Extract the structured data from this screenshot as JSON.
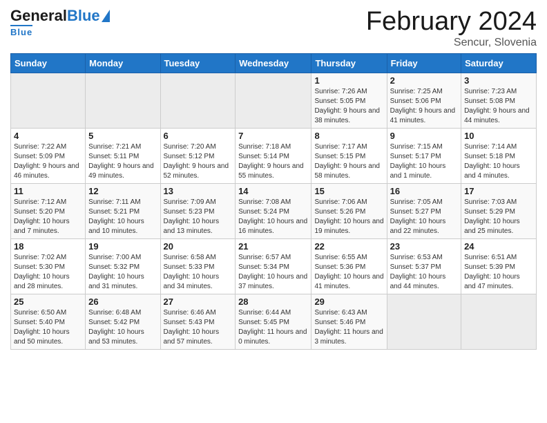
{
  "header": {
    "logo_general": "General",
    "logo_blue": "Blue",
    "month": "February 2024",
    "location": "Sencur, Slovenia"
  },
  "days_of_week": [
    "Sunday",
    "Monday",
    "Tuesday",
    "Wednesday",
    "Thursday",
    "Friday",
    "Saturday"
  ],
  "weeks": [
    [
      {
        "day": "",
        "info": ""
      },
      {
        "day": "",
        "info": ""
      },
      {
        "day": "",
        "info": ""
      },
      {
        "day": "",
        "info": ""
      },
      {
        "day": "1",
        "info": "Sunrise: 7:26 AM\nSunset: 5:05 PM\nDaylight: 9 hours and 38 minutes."
      },
      {
        "day": "2",
        "info": "Sunrise: 7:25 AM\nSunset: 5:06 PM\nDaylight: 9 hours and 41 minutes."
      },
      {
        "day": "3",
        "info": "Sunrise: 7:23 AM\nSunset: 5:08 PM\nDaylight: 9 hours and 44 minutes."
      }
    ],
    [
      {
        "day": "4",
        "info": "Sunrise: 7:22 AM\nSunset: 5:09 PM\nDaylight: 9 hours and 46 minutes."
      },
      {
        "day": "5",
        "info": "Sunrise: 7:21 AM\nSunset: 5:11 PM\nDaylight: 9 hours and 49 minutes."
      },
      {
        "day": "6",
        "info": "Sunrise: 7:20 AM\nSunset: 5:12 PM\nDaylight: 9 hours and 52 minutes."
      },
      {
        "day": "7",
        "info": "Sunrise: 7:18 AM\nSunset: 5:14 PM\nDaylight: 9 hours and 55 minutes."
      },
      {
        "day": "8",
        "info": "Sunrise: 7:17 AM\nSunset: 5:15 PM\nDaylight: 9 hours and 58 minutes."
      },
      {
        "day": "9",
        "info": "Sunrise: 7:15 AM\nSunset: 5:17 PM\nDaylight: 10 hours and 1 minute."
      },
      {
        "day": "10",
        "info": "Sunrise: 7:14 AM\nSunset: 5:18 PM\nDaylight: 10 hours and 4 minutes."
      }
    ],
    [
      {
        "day": "11",
        "info": "Sunrise: 7:12 AM\nSunset: 5:20 PM\nDaylight: 10 hours and 7 minutes."
      },
      {
        "day": "12",
        "info": "Sunrise: 7:11 AM\nSunset: 5:21 PM\nDaylight: 10 hours and 10 minutes."
      },
      {
        "day": "13",
        "info": "Sunrise: 7:09 AM\nSunset: 5:23 PM\nDaylight: 10 hours and 13 minutes."
      },
      {
        "day": "14",
        "info": "Sunrise: 7:08 AM\nSunset: 5:24 PM\nDaylight: 10 hours and 16 minutes."
      },
      {
        "day": "15",
        "info": "Sunrise: 7:06 AM\nSunset: 5:26 PM\nDaylight: 10 hours and 19 minutes."
      },
      {
        "day": "16",
        "info": "Sunrise: 7:05 AM\nSunset: 5:27 PM\nDaylight: 10 hours and 22 minutes."
      },
      {
        "day": "17",
        "info": "Sunrise: 7:03 AM\nSunset: 5:29 PM\nDaylight: 10 hours and 25 minutes."
      }
    ],
    [
      {
        "day": "18",
        "info": "Sunrise: 7:02 AM\nSunset: 5:30 PM\nDaylight: 10 hours and 28 minutes."
      },
      {
        "day": "19",
        "info": "Sunrise: 7:00 AM\nSunset: 5:32 PM\nDaylight: 10 hours and 31 minutes."
      },
      {
        "day": "20",
        "info": "Sunrise: 6:58 AM\nSunset: 5:33 PM\nDaylight: 10 hours and 34 minutes."
      },
      {
        "day": "21",
        "info": "Sunrise: 6:57 AM\nSunset: 5:34 PM\nDaylight: 10 hours and 37 minutes."
      },
      {
        "day": "22",
        "info": "Sunrise: 6:55 AM\nSunset: 5:36 PM\nDaylight: 10 hours and 41 minutes."
      },
      {
        "day": "23",
        "info": "Sunrise: 6:53 AM\nSunset: 5:37 PM\nDaylight: 10 hours and 44 minutes."
      },
      {
        "day": "24",
        "info": "Sunrise: 6:51 AM\nSunset: 5:39 PM\nDaylight: 10 hours and 47 minutes."
      }
    ],
    [
      {
        "day": "25",
        "info": "Sunrise: 6:50 AM\nSunset: 5:40 PM\nDaylight: 10 hours and 50 minutes."
      },
      {
        "day": "26",
        "info": "Sunrise: 6:48 AM\nSunset: 5:42 PM\nDaylight: 10 hours and 53 minutes."
      },
      {
        "day": "27",
        "info": "Sunrise: 6:46 AM\nSunset: 5:43 PM\nDaylight: 10 hours and 57 minutes."
      },
      {
        "day": "28",
        "info": "Sunrise: 6:44 AM\nSunset: 5:45 PM\nDaylight: 11 hours and 0 minutes."
      },
      {
        "day": "29",
        "info": "Sunrise: 6:43 AM\nSunset: 5:46 PM\nDaylight: 11 hours and 3 minutes."
      },
      {
        "day": "",
        "info": ""
      },
      {
        "day": "",
        "info": ""
      }
    ]
  ]
}
